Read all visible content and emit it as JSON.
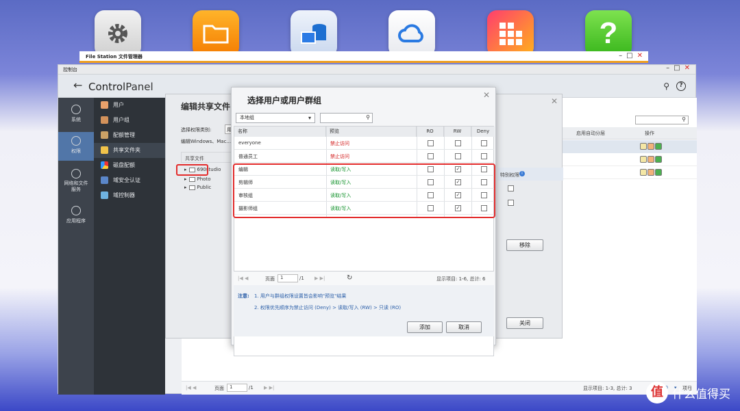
{
  "desktop": {
    "icons": [
      "gear-icon",
      "folder-icon",
      "storage-icon",
      "cloud-icon",
      "apps-icon",
      "help-icon"
    ]
  },
  "file_station": {
    "title": "File Station 文件管理器"
  },
  "control_panel_window": {
    "title": "控制台",
    "logo_a": "Control",
    "logo_b": "Panel"
  },
  "left_nav": [
    {
      "label": "系统"
    },
    {
      "label": "权限"
    },
    {
      "label": "网络和文件服务"
    },
    {
      "label": "应用程序"
    }
  ],
  "sub_nav": [
    {
      "label": "用户"
    },
    {
      "label": "用户组"
    },
    {
      "label": "配额管理"
    },
    {
      "label": "共享文件夹"
    },
    {
      "label": "磁盘配额"
    },
    {
      "label": "域安全认证"
    },
    {
      "label": "域控制器"
    }
  ],
  "main": {
    "col_tier": "启用自动分层",
    "col_op": "操作",
    "pager_page": "页面",
    "pager_val": "1",
    "pager_total": "/1",
    "status": "显示项目: 1-3, 总计: 3",
    "show": "显示",
    "show_val": "10",
    "items": "项目"
  },
  "edit_dialog": {
    "title": "编辑共享文件",
    "perm_type_label": "选择权限类别:",
    "perm_type_val": "用",
    "desc": "编辑Windows、Mac...",
    "tree_header": "共享文件",
    "folders": [
      "690studio",
      "Photo",
      "Public"
    ],
    "special_perm": "特别权限",
    "remove": "移除",
    "close": "关闭"
  },
  "select_dialog": {
    "title": "选择用户或用户群组",
    "scope": "本地组",
    "search_placeholder": "",
    "headers": {
      "name": "名称",
      "preview": "预览",
      "ro": "RO",
      "rw": "RW",
      "deny": "Deny"
    },
    "rows": [
      {
        "name": "everyone",
        "preview": "禁止访问",
        "ro": false,
        "rw": false,
        "deny": false,
        "kind": "deny"
      },
      {
        "name": "普通员工",
        "preview": "禁止访问",
        "ro": false,
        "rw": false,
        "deny": false,
        "kind": "deny"
      },
      {
        "name": "编辑",
        "preview": "读取/写入",
        "ro": false,
        "rw": true,
        "deny": false,
        "kind": "rw"
      },
      {
        "name": "剪辑师",
        "preview": "读取/写入",
        "ro": false,
        "rw": true,
        "deny": false,
        "kind": "rw"
      },
      {
        "name": "审核组",
        "preview": "读取/写入",
        "ro": false,
        "rw": true,
        "deny": false,
        "kind": "rw"
      },
      {
        "name": "摄影师组",
        "preview": "读取/写入",
        "ro": false,
        "rw": true,
        "deny": false,
        "kind": "rw"
      }
    ],
    "pager": {
      "page_label": "页面",
      "page_val": "1",
      "page_total": "/1",
      "status": "显示项目: 1-6, 总计: 6"
    },
    "note_label": "注意:",
    "notes": [
      "1. 用户与群组权限设置皆会影响\"预览\"结果",
      "2. 权限优先顺序为禁止访问 (Deny) > 读取/写入 (RW) > 只读 (RO)"
    ],
    "add": "添加",
    "cancel": "取消"
  },
  "watermark": {
    "logo": "值",
    "text": "什么值得买"
  }
}
